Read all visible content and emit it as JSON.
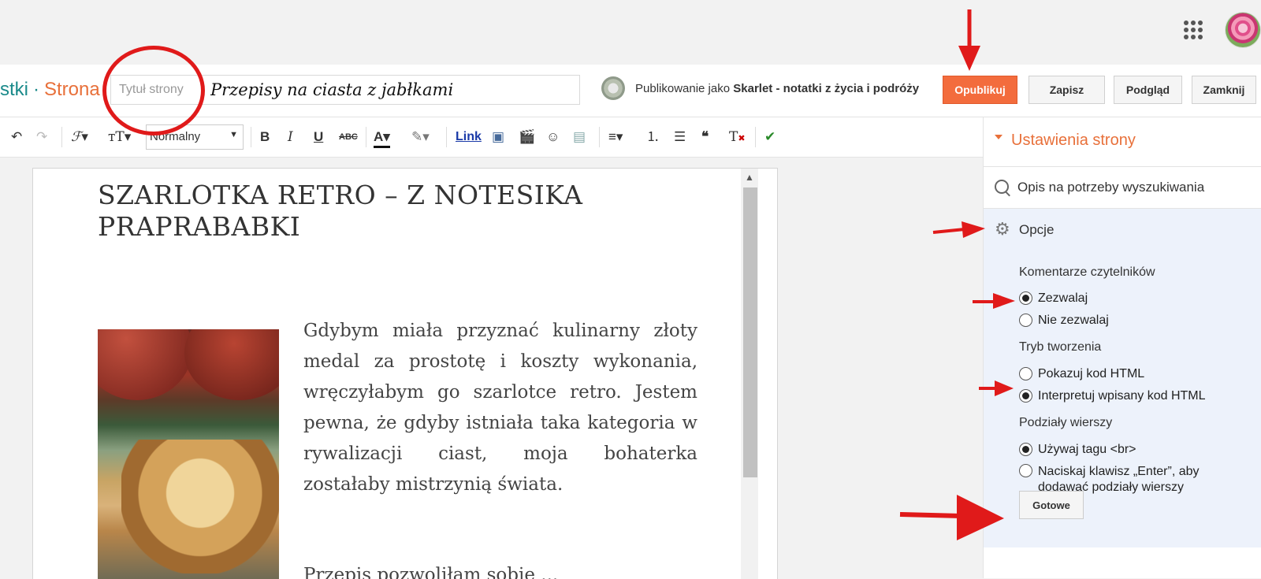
{
  "topbar": {
    "apps_icon": "apps-grid-icon",
    "avatar_icon": "rose-avatar"
  },
  "header": {
    "crumb_blog": "stki",
    "crumb_sep": "·",
    "crumb_page": "Strona",
    "title_placeholder": "Tytuł strony",
    "title_value": "Przepisy na ciasta z jabłkami",
    "publishing_prefix": "Publikowanie jako",
    "publishing_blog": "Skarlet - notatki z życia i podróży",
    "buttons": {
      "publish": "Opublikuj",
      "save": "Zapisz",
      "preview": "Podgląd",
      "close": "Zamknij"
    }
  },
  "toolbar": {
    "format_value": "Normalny",
    "link_label": "Link"
  },
  "editor": {
    "post_title": "Szarlotka retro – z notesika praprababki",
    "paragraph1": "Gdybym miała przyznać kulinarny złoty medal za prostotę i koszty wykonania, wręczyłabym go szarlotce retro. Jestem pewna, że gdyby istniała taka kategoria w rywalizacji ciast, moja bohaterka zostałaby mistrzynią świata.",
    "paragraph2": "Przepis pozwoliłam sobie ..."
  },
  "panel": {
    "title": "Ustawienia strony",
    "seo_label": "Opis na potrzeby wyszukiwania",
    "options_label": "Opcje",
    "comments_label": "Komentarze czytelników",
    "comments_allow": "Zezwalaj",
    "comments_deny": "Nie zezwalaj",
    "mode_label": "Tryb tworzenia",
    "mode_show_html": "Pokazuj kod HTML",
    "mode_interpret": "Interpretuj wpisany kod HTML",
    "breaks_label": "Podziały wierszy",
    "breaks_br": "Używaj tagu <br>",
    "breaks_enter": "Naciskaj klawisz „Enter”, aby dodawać podziały wierszy",
    "done_button": "Gotowe",
    "selected": {
      "comments": "allow",
      "mode": "interpret",
      "breaks": "br"
    }
  },
  "colors": {
    "accent": "#f36c3d",
    "annotation": "#e01a1a",
    "teal": "#1a8a8a",
    "panel_bg": "#edf2fb"
  }
}
